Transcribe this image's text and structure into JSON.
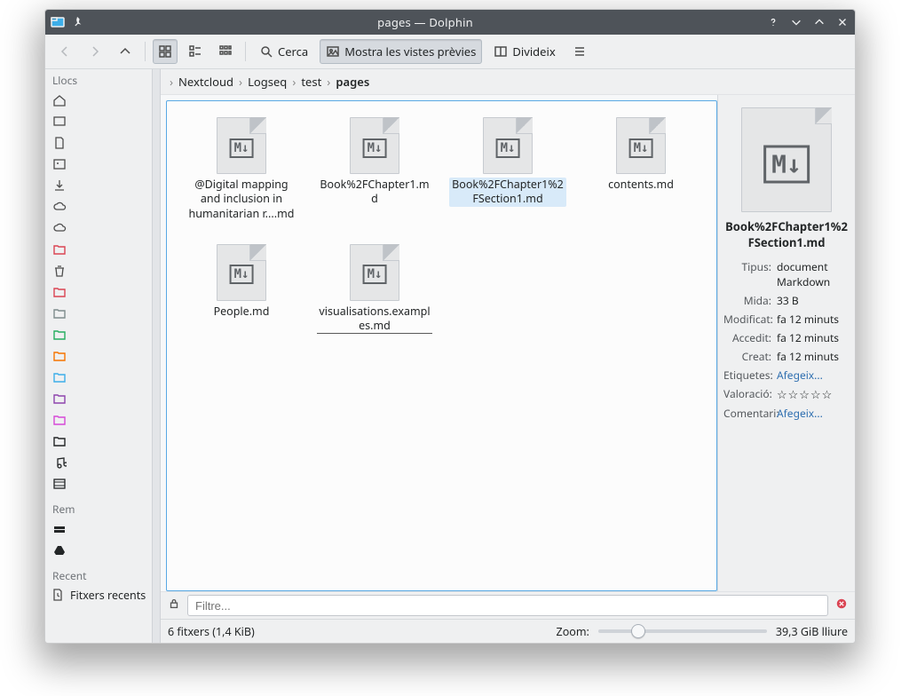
{
  "window": {
    "title": "pages — Dolphin"
  },
  "toolbar": {
    "search_label": "Cerca",
    "preview_label": "Mostra les vistes prèvies",
    "split_label": "Divideix"
  },
  "places": {
    "title": "Llocs",
    "remote_title": "Rem",
    "recent_title": "Recent",
    "recent_item": "Fitxers recents"
  },
  "breadcrumb": {
    "segments": [
      "Nextcloud",
      "Logseq",
      "test"
    ],
    "current": "pages"
  },
  "files": {
    "items": [
      "@Digital mapping and inclusion in humanitarian r....md",
      "Book%2FChapter1.md",
      "Book%2FChapter1%2FSection1.md",
      "contents.md",
      "People.md",
      "visualisations.examples.md"
    ],
    "selected_index": 2,
    "rename_index": 5
  },
  "filter": {
    "placeholder": "Filtre..."
  },
  "status": {
    "count_text": "6 fitxers (1,4 KiB)",
    "zoom_label": "Zoom:",
    "free_text": "39,3 GiB lliure"
  },
  "info": {
    "filename": "Book%2FChapter1%2FSection1.md",
    "labels": {
      "type": "Tipus:",
      "size": "Mida:",
      "modified": "Modificat:",
      "accessed": "Accedit:",
      "created": "Creat:",
      "tags": "Etiquetes:",
      "rating": "Valoració:",
      "comment": "Comentari:"
    },
    "values": {
      "type": "document Markdown",
      "size": "33 B",
      "modified": "fa 12 minuts",
      "accessed": "fa 12 minuts",
      "created": "fa 12 minuts",
      "tags_link": "Afegeix...",
      "rating": "☆☆☆☆☆",
      "comment_link": "Afegeix..."
    }
  }
}
